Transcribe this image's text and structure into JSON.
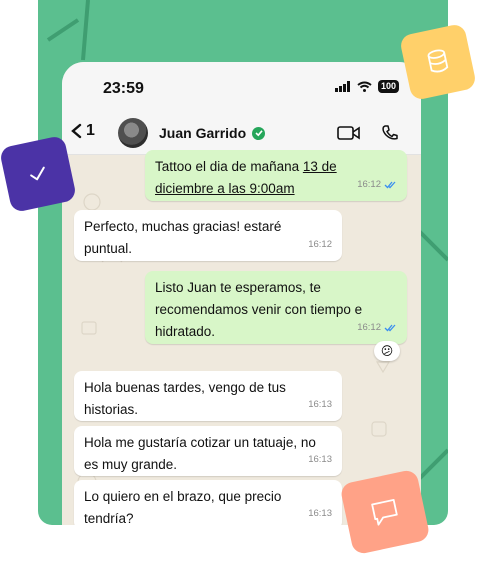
{
  "status_bar": {
    "time": "23:59",
    "battery": "100"
  },
  "header": {
    "back_count": "1",
    "contact_name": "Juan Garrido"
  },
  "messages": [
    {
      "direction": "out",
      "line1": "Tattoo el dia de mañana ",
      "line1_link": "13 de",
      "line2_link": "diciembre a las 9:00am",
      "time": "16:12",
      "read": true
    },
    {
      "direction": "in",
      "text": "Perfecto, muchas gracias! estaré puntual.",
      "time": "16:12"
    },
    {
      "direction": "out",
      "text": "Listo Juan te esperamos, te recomendamos venir con tiempo e hidratado.",
      "time": "16:12",
      "read": true,
      "reaction": "😕"
    },
    {
      "direction": "in",
      "text": "Hola buenas tardes, vengo de tus historias.",
      "time": "16:13"
    },
    {
      "direction": "in",
      "text": "Hola me gustaría cotizar un tatuaje, no es muy grande.",
      "time": "16:13"
    },
    {
      "direction": "in",
      "text": "Lo quiero en el brazo, que precio tendría?",
      "time": "16:13"
    }
  ],
  "colors": {
    "accent_green": "#5bbf8f",
    "bubble_out": "#d8f6c8",
    "purple": "#4b33a6",
    "yellow": "#ffd06a",
    "coral": "#ffa287"
  },
  "floating_icons": [
    "check-icon",
    "database-icon",
    "chat-bubble-icon"
  ]
}
